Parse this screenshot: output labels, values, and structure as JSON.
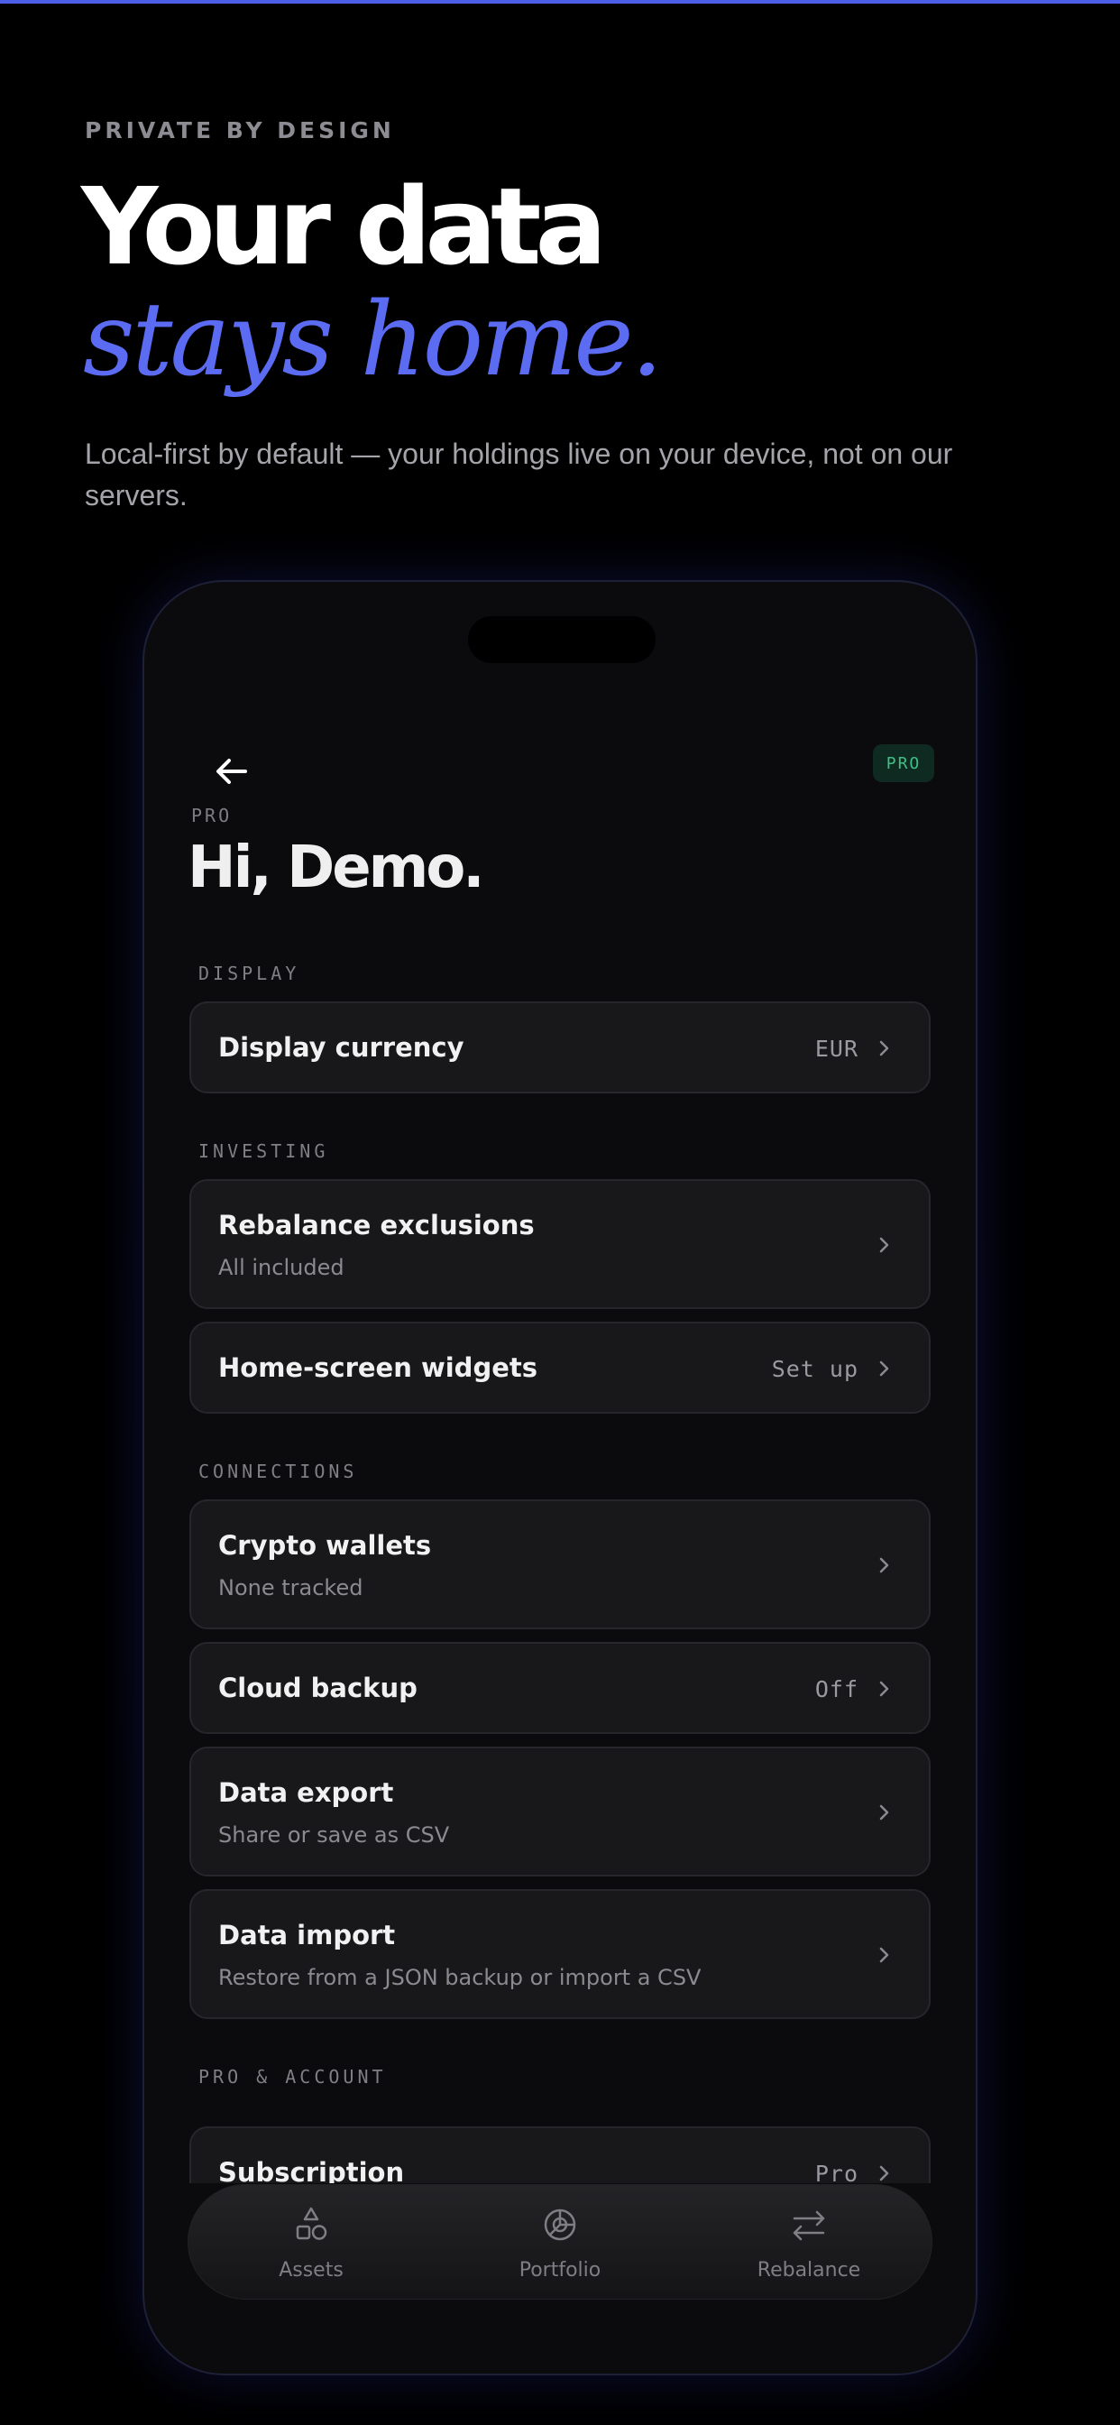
{
  "hero": {
    "eyebrow": "PRIVATE BY DESIGN",
    "title_line1": "Your data",
    "title_line2": "stays home.",
    "subtitle": "Local-first by default — your holdings live on your device, not on our servers.",
    "accent_color": "#5b6cf2"
  },
  "screen": {
    "badge": "PRO",
    "plan_label": "PRO",
    "greeting": "Hi, Demo.",
    "sections": {
      "display": {
        "title": "DISPLAY",
        "items": [
          {
            "title": "Display currency",
            "value": "EUR"
          }
        ]
      },
      "investing": {
        "title": "INVESTING",
        "items": [
          {
            "title": "Rebalance exclusions",
            "subtitle": "All included"
          },
          {
            "title": "Home-screen widgets",
            "value": "Set up"
          }
        ]
      },
      "connections": {
        "title": "CONNECTIONS",
        "items": [
          {
            "title": "Crypto wallets",
            "subtitle": "None tracked"
          },
          {
            "title": "Cloud backup",
            "value": "Off"
          },
          {
            "title": "Data export",
            "subtitle": "Share or save as CSV"
          },
          {
            "title": "Data import",
            "subtitle": "Restore from a JSON backup or import a CSV"
          }
        ]
      },
      "pro_account": {
        "title": "PRO & ACCOUNT",
        "items": [
          {
            "title": "Subscription",
            "value": "Pro"
          }
        ]
      }
    },
    "tabs": [
      {
        "label": "Assets",
        "icon": "shapes-icon"
      },
      {
        "label": "Portfolio",
        "icon": "pie-chart-icon"
      },
      {
        "label": "Rebalance",
        "icon": "swap-arrows-icon"
      }
    ],
    "badge_color": "#3fbf86"
  }
}
